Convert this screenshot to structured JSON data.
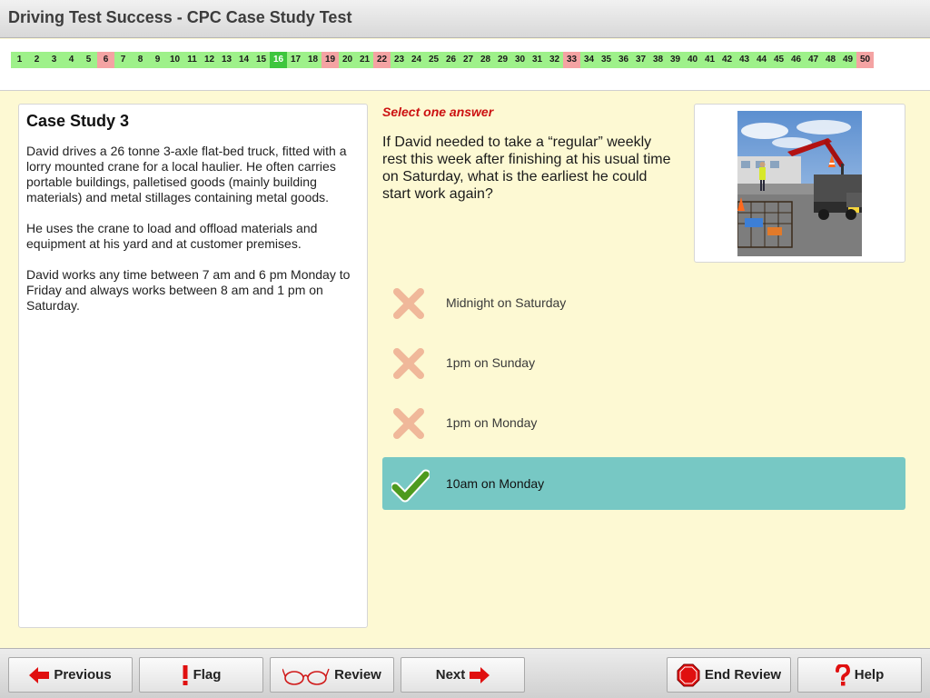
{
  "app": {
    "title": "Driving Test Success - CPC Case Study Test"
  },
  "question_nav": [
    {
      "n": "1",
      "state": "correct"
    },
    {
      "n": "2",
      "state": "correct"
    },
    {
      "n": "3",
      "state": "correct"
    },
    {
      "n": "4",
      "state": "correct"
    },
    {
      "n": "5",
      "state": "correct"
    },
    {
      "n": "6",
      "state": "wrong"
    },
    {
      "n": "7",
      "state": "correct"
    },
    {
      "n": "8",
      "state": "correct"
    },
    {
      "n": "9",
      "state": "correct"
    },
    {
      "n": "10",
      "state": "correct"
    },
    {
      "n": "11",
      "state": "correct"
    },
    {
      "n": "12",
      "state": "correct"
    },
    {
      "n": "13",
      "state": "correct"
    },
    {
      "n": "14",
      "state": "correct"
    },
    {
      "n": "15",
      "state": "correct"
    },
    {
      "n": "16",
      "state": "current"
    },
    {
      "n": "17",
      "state": "correct"
    },
    {
      "n": "18",
      "state": "correct"
    },
    {
      "n": "19",
      "state": "wrong"
    },
    {
      "n": "20",
      "state": "correct"
    },
    {
      "n": "21",
      "state": "correct"
    },
    {
      "n": "22",
      "state": "wrong"
    },
    {
      "n": "23",
      "state": "correct"
    },
    {
      "n": "24",
      "state": "correct"
    },
    {
      "n": "25",
      "state": "correct"
    },
    {
      "n": "26",
      "state": "correct"
    },
    {
      "n": "27",
      "state": "correct"
    },
    {
      "n": "28",
      "state": "correct"
    },
    {
      "n": "29",
      "state": "correct"
    },
    {
      "n": "30",
      "state": "correct"
    },
    {
      "n": "31",
      "state": "correct"
    },
    {
      "n": "32",
      "state": "correct"
    },
    {
      "n": "33",
      "state": "wrong"
    },
    {
      "n": "34",
      "state": "correct"
    },
    {
      "n": "35",
      "state": "correct"
    },
    {
      "n": "36",
      "state": "correct"
    },
    {
      "n": "37",
      "state": "correct"
    },
    {
      "n": "38",
      "state": "correct"
    },
    {
      "n": "39",
      "state": "correct"
    },
    {
      "n": "40",
      "state": "correct"
    },
    {
      "n": "41",
      "state": "correct"
    },
    {
      "n": "42",
      "state": "correct"
    },
    {
      "n": "43",
      "state": "correct"
    },
    {
      "n": "44",
      "state": "correct"
    },
    {
      "n": "45",
      "state": "correct"
    },
    {
      "n": "46",
      "state": "correct"
    },
    {
      "n": "47",
      "state": "correct"
    },
    {
      "n": "48",
      "state": "correct"
    },
    {
      "n": "49",
      "state": "correct"
    },
    {
      "n": "50",
      "state": "wrong"
    }
  ],
  "case_study": {
    "title": "Case Study 3",
    "paragraphs": [
      "David drives a 26 tonne 3-axle flat-bed truck, fitted with a lorry mounted crane for a local haulier. He often carries portable buildings, palletised goods (mainly building materials) and metal stillages containing metal goods.",
      "He uses the crane to load and offload materials and equipment at his yard and at customer premises.",
      "David works any time between 7 am and 6 pm Monday to Friday and always works between 8 am and 1 pm on Saturday."
    ]
  },
  "question": {
    "instruction": "Select one answer",
    "text": "If David needed to take a “regular” weekly rest this week after finishing at his usual time on Saturday, what is the earliest he could start work again?",
    "answers": [
      {
        "text": "Midnight on Saturday",
        "result": "incorrect"
      },
      {
        "text": "1pm on Sunday",
        "result": "incorrect"
      },
      {
        "text": "1pm on Monday",
        "result": "incorrect"
      },
      {
        "text": "10am on Monday",
        "result": "correct"
      }
    ]
  },
  "footer": {
    "previous": "Previous",
    "flag": "Flag",
    "review": "Review",
    "next": "Next",
    "end_review": "End Review",
    "help": "Help"
  },
  "colors": {
    "nav_correct": "#9ef18a",
    "nav_wrong": "#f4a3a3",
    "nav_current": "#3ec63e",
    "correct_answer_bg": "#77c8c4",
    "cross": "#f0b89a",
    "tick": "#4e9a1e",
    "instruction": "#cc1111",
    "content_bg": "#fdf9d3"
  }
}
